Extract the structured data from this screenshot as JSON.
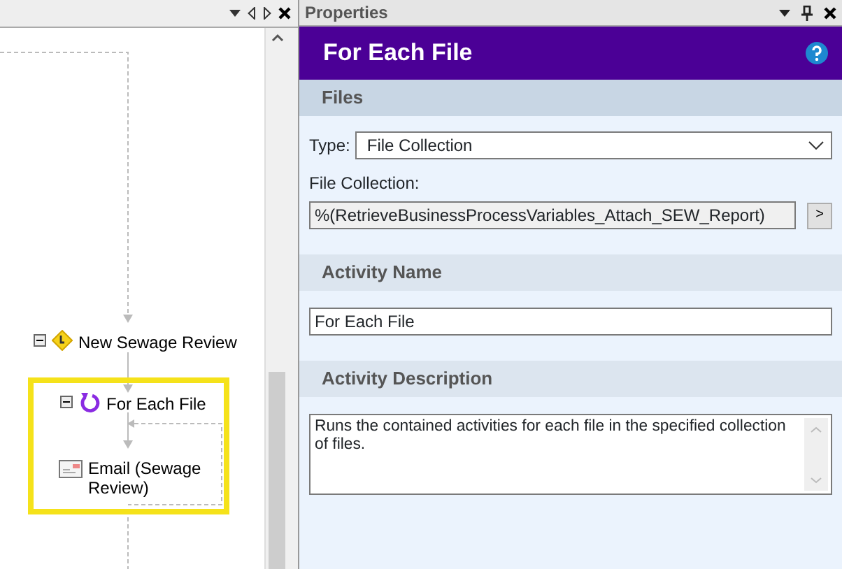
{
  "designer": {
    "nodes": [
      {
        "kind": "decision",
        "label": "New Sewage Review",
        "expanded": true
      },
      {
        "kind": "loop",
        "label": "For Each File",
        "expanded": true,
        "selected": true
      },
      {
        "kind": "email",
        "label": "Email (Sewage Review)"
      }
    ]
  },
  "properties": {
    "title": "Properties",
    "header": "For Each File",
    "sections": [
      {
        "title": "Files",
        "fields": [
          {
            "kind": "select",
            "label": "Type:",
            "value": "File Collection"
          },
          {
            "kind": "picker",
            "label": "File Collection:",
            "value": "%(RetrieveBusinessProcessVariables_Attach_SEW_Report)",
            "button": ">"
          }
        ]
      },
      {
        "title": "Activity Name",
        "fields": [
          {
            "kind": "text",
            "value": "For Each File"
          }
        ]
      },
      {
        "title": "Activity Description",
        "fields": [
          {
            "kind": "textarea",
            "value": "Runs the contained activities for each file in the specified collection of files."
          }
        ]
      }
    ]
  }
}
